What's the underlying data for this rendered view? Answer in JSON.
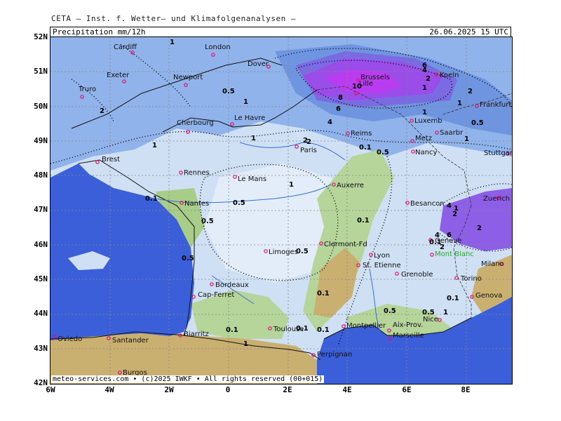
{
  "header": {
    "org_text": "CETA — Inst. f. Wetter— und Klimafolgenanalysen —"
  },
  "title_bar": {
    "left": "Precipitation  mm/12h",
    "right": "26.06.2025 15 UTC"
  },
  "axes": {
    "lat_labels": [
      "52N",
      "51N",
      "50N",
      "49N",
      "48N",
      "47N",
      "46N",
      "45N",
      "44N",
      "43N",
      "42N"
    ],
    "lon_labels": [
      "6W",
      "4W",
      "2W",
      "0",
      "2E",
      "4E",
      "6E",
      "8E"
    ]
  },
  "copyright": "meteo-services.com • (c)2025 IWKF • All rights reserved (00+015)",
  "cities": [
    {
      "name": "Cardiff"
    },
    {
      "name": "London"
    },
    {
      "name": "Dover"
    },
    {
      "name": "Exeter"
    },
    {
      "name": "Truro"
    },
    {
      "name": "Newport"
    },
    {
      "name": "Cherbourg"
    },
    {
      "name": "Le Havre"
    },
    {
      "name": "Brest"
    },
    {
      "name": "Rennes"
    },
    {
      "name": "Le Mans"
    },
    {
      "name": "Paris"
    },
    {
      "name": "Reims"
    },
    {
      "name": "Lille"
    },
    {
      "name": "Brussels"
    },
    {
      "name": "Koeln"
    },
    {
      "name": "Frankfurt"
    },
    {
      "name": "Luxemb"
    },
    {
      "name": "Saarbr"
    },
    {
      "name": "Metz"
    },
    {
      "name": "Nancy"
    },
    {
      "name": "Stuttgart"
    },
    {
      "name": "Auxerre"
    },
    {
      "name": "Besancon"
    },
    {
      "name": "Zuerich"
    },
    {
      "name": "Nantes"
    },
    {
      "name": "Limoges"
    },
    {
      "name": "Clermont-Fd"
    },
    {
      "name": "Lyon"
    },
    {
      "name": "St. Etienne"
    },
    {
      "name": "Geneve"
    },
    {
      "name": "Mont Blanc"
    },
    {
      "name": "Grenoble"
    },
    {
      "name": "Milano"
    },
    {
      "name": "Torino"
    },
    {
      "name": "Genova"
    },
    {
      "name": "Bordeaux"
    },
    {
      "name": "Cap-Ferret"
    },
    {
      "name": "Biarritz"
    },
    {
      "name": "Toulouse"
    },
    {
      "name": "Montpellier"
    },
    {
      "name": "Aix-Prov."
    },
    {
      "name": "Marseille"
    },
    {
      "name": "Nice"
    },
    {
      "name": "Perpignan"
    },
    {
      "name": "Oviedo"
    },
    {
      "name": "Santander"
    },
    {
      "name": "Burgos"
    }
  ],
  "contour_labels": [
    "1",
    "0.5",
    "2",
    "1",
    "1",
    "2",
    "4",
    "6",
    "8",
    "10",
    "6",
    "4",
    "2",
    "1",
    "1",
    "0.5",
    "2",
    "1",
    "0.1",
    "0.5",
    "1",
    "0.5",
    "2",
    "1",
    "4",
    "6",
    "2",
    "4",
    "0.5",
    "0.1",
    "0.5",
    "1",
    "0.1",
    "0.5",
    "0.1",
    "0.1",
    "0.5",
    "0.1",
    "1",
    "2",
    "0.1",
    "0.5",
    "0.1",
    "1",
    "2",
    "1",
    "0.1"
  ],
  "colors": {
    "sea": "#3a5fd8",
    "precip_0_1": "#d8e6f7",
    "precip_0_5": "#b3cdf0",
    "precip_1": "#8fb3ea",
    "precip_2": "#6f95e0",
    "precip_4": "#7b6be3",
    "precip_6": "#9a4de8",
    "precip_10": "#b93cf0",
    "terrain_low": "#b5d59a",
    "terrain_mid": "#9ec97a",
    "terrain_high": "#c9b071",
    "city_marker": "#e0106e"
  }
}
